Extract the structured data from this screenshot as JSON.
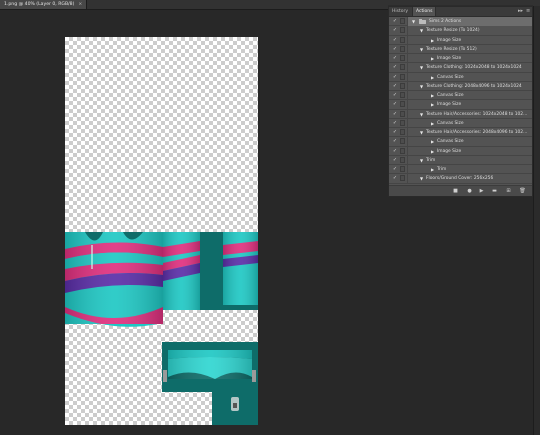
{
  "document_tab": {
    "title": "1.png @ 40% (Layer 0, RGB/8)",
    "close": "×"
  },
  "panel": {
    "tabs": [
      "History",
      "Actions"
    ],
    "active_tab": "Actions",
    "controls": {
      "collapse": "▸▸",
      "menu": "≡"
    },
    "rows": [
      {
        "level": 0,
        "check": "✓",
        "folder": true,
        "open": true,
        "label": "Sims 2 Actions",
        "selected": true
      },
      {
        "level": 1,
        "check": "✓",
        "open": true,
        "label": "Texture Resize (To 1024)"
      },
      {
        "level": 2,
        "check": "✓",
        "open": false,
        "label": "Image Size"
      },
      {
        "level": 1,
        "check": "✓",
        "open": true,
        "label": "Texture Resize (To 512)"
      },
      {
        "level": 2,
        "check": "✓",
        "open": false,
        "label": "Image Size"
      },
      {
        "level": 1,
        "check": "✓",
        "open": true,
        "label": "Texture Clothing: 1024x2048 to 1024x1024"
      },
      {
        "level": 2,
        "check": "✓",
        "open": false,
        "label": "Canvas Size"
      },
      {
        "level": 1,
        "check": "✓",
        "open": true,
        "label": "Texture Clothing: 2048x4096 to 1024x1024"
      },
      {
        "level": 2,
        "check": "✓",
        "open": false,
        "label": "Canvas Size"
      },
      {
        "level": 2,
        "check": "✓",
        "open": false,
        "label": "Image Size"
      },
      {
        "level": 1,
        "check": "✓",
        "open": true,
        "label": "Texture Hair/Accessories: 1024x2048 to 102..."
      },
      {
        "level": 2,
        "check": "✓",
        "open": false,
        "label": "Canvas Size"
      },
      {
        "level": 1,
        "check": "✓",
        "open": true,
        "label": "Texture Hair/Accessories: 2048x4096 to 102..."
      },
      {
        "level": 2,
        "check": "✓",
        "open": false,
        "label": "Canvas Size"
      },
      {
        "level": 2,
        "check": "✓",
        "open": false,
        "label": "Image Size"
      },
      {
        "level": 1,
        "check": "✓",
        "open": true,
        "label": "Trim"
      },
      {
        "level": 2,
        "check": "✓",
        "open": false,
        "label": "Trim"
      },
      {
        "level": 1,
        "check": "✓",
        "open": true,
        "label": "Floors/Ground Cover: 256x256"
      }
    ],
    "footer_buttons": [
      {
        "name": "stop-button",
        "glyph": "■"
      },
      {
        "name": "record-button",
        "glyph": "●"
      },
      {
        "name": "play-button",
        "glyph": "▶"
      },
      {
        "name": "new-set-button",
        "glyph": "▬"
      },
      {
        "name": "new-action-button",
        "glyph": "⊞"
      },
      {
        "name": "delete-button",
        "glyph": "🗑"
      }
    ]
  },
  "colors": {
    "teal": "#1fc8c4",
    "dark_teal": "#0e6c69",
    "pink": "#e0307f",
    "purple": "#5b2ea8",
    "panel": "#535353",
    "workspace": "#282828"
  }
}
